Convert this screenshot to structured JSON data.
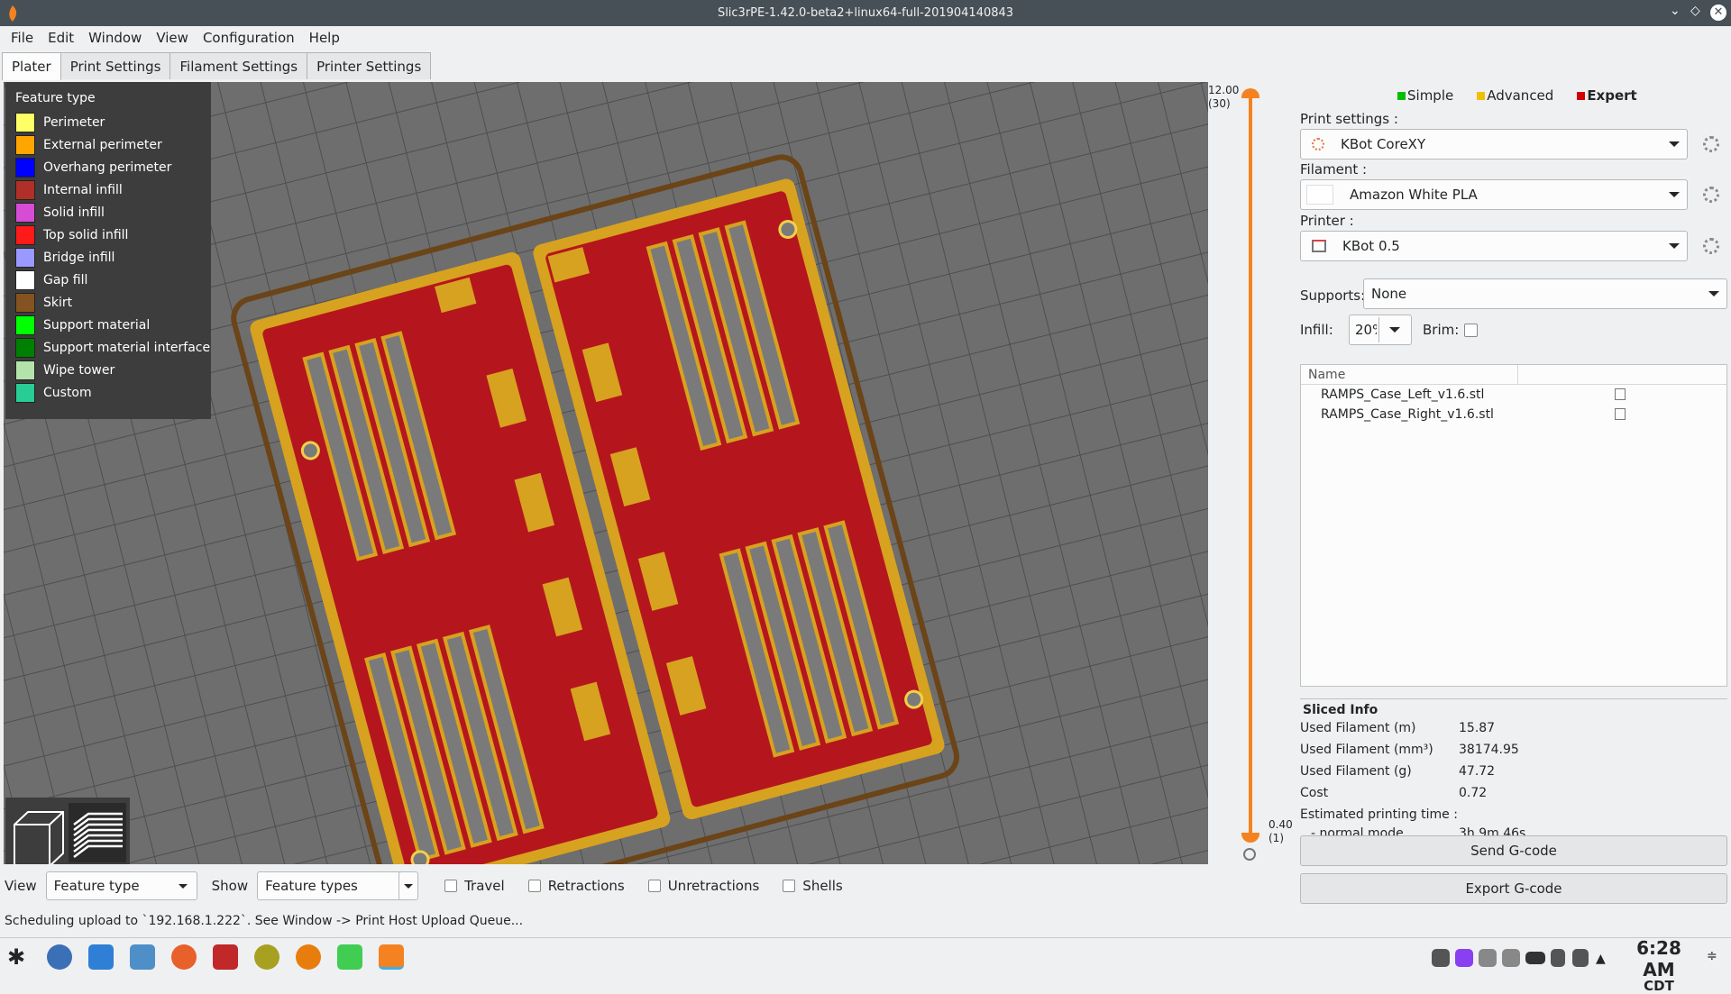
{
  "window": {
    "title": "Slic3rPE-1.42.0-beta2+linux64-full-201904140843"
  },
  "menu": [
    "File",
    "Edit",
    "Window",
    "View",
    "Configuration",
    "Help"
  ],
  "tabs": [
    "Plater",
    "Print Settings",
    "Filament Settings",
    "Printer Settings"
  ],
  "legend": {
    "title": "Feature type",
    "items": [
      {
        "label": "Perimeter",
        "color": "#ffff66"
      },
      {
        "label": "External perimeter",
        "color": "#ffa500"
      },
      {
        "label": "Overhang perimeter",
        "color": "#0000ff"
      },
      {
        "label": "Internal infill",
        "color": "#b03029"
      },
      {
        "label": "Solid infill",
        "color": "#d64cd6"
      },
      {
        "label": "Top solid infill",
        "color": "#ff1a1a"
      },
      {
        "label": "Bridge infill",
        "color": "#9999ff"
      },
      {
        "label": "Gap fill",
        "color": "#ffffff"
      },
      {
        "label": "Skirt",
        "color": "#845321"
      },
      {
        "label": "Support material",
        "color": "#00ff00"
      },
      {
        "label": "Support material interface",
        "color": "#008000"
      },
      {
        "label": "Wipe tower",
        "color": "#b3e3ab"
      },
      {
        "label": "Custom",
        "color": "#28cc94"
      }
    ]
  },
  "layer_slider": {
    "top_value": "12.00",
    "top_layer": "(30)",
    "bottom_value": "0.40",
    "bottom_layer": "(1)"
  },
  "modes": {
    "simple": "Simple",
    "advanced": "Advanced",
    "expert": "Expert"
  },
  "print_settings": {
    "label": "Print settings :",
    "value": "KBot CoreXY"
  },
  "filament": {
    "label": "Filament :",
    "value": "Amazon White PLA"
  },
  "printer": {
    "label": "Printer :",
    "value": "KBot 0.5"
  },
  "supports": {
    "label": "Supports:",
    "value": "None"
  },
  "infill": {
    "label": "Infill:",
    "value": "20%"
  },
  "brim": {
    "label": "Brim:"
  },
  "object_list": {
    "header": "Name",
    "items": [
      "RAMPS_Case_Left_v1.6.stl",
      "RAMPS_Case_Right_v1.6.stl"
    ]
  },
  "sliced_info": {
    "title": "Sliced Info",
    "rows": [
      {
        "k": "Used Filament (m)",
        "v": "15.87"
      },
      {
        "k": "Used Filament (mm³)",
        "v": "38174.95"
      },
      {
        "k": "Used Filament (g)",
        "v": "47.72"
      },
      {
        "k": "Cost",
        "v": "0.72"
      }
    ],
    "time_label": "Estimated printing time :",
    "mode_label": "- normal mode",
    "mode_value": "3h 9m 46s"
  },
  "buttons": {
    "send": "Send G-code",
    "export": "Export G-code"
  },
  "bottom": {
    "view_label": "View",
    "view_value": "Feature type",
    "show_label": "Show",
    "show_value": "Feature types",
    "checks": [
      "Travel",
      "Retractions",
      "Unretractions",
      "Shells"
    ]
  },
  "status": "Scheduling upload to `192.168.1.222`. See Window -> Print Host Upload Queue...",
  "clock": {
    "time": "6:28 AM",
    "zone": "CDT"
  }
}
